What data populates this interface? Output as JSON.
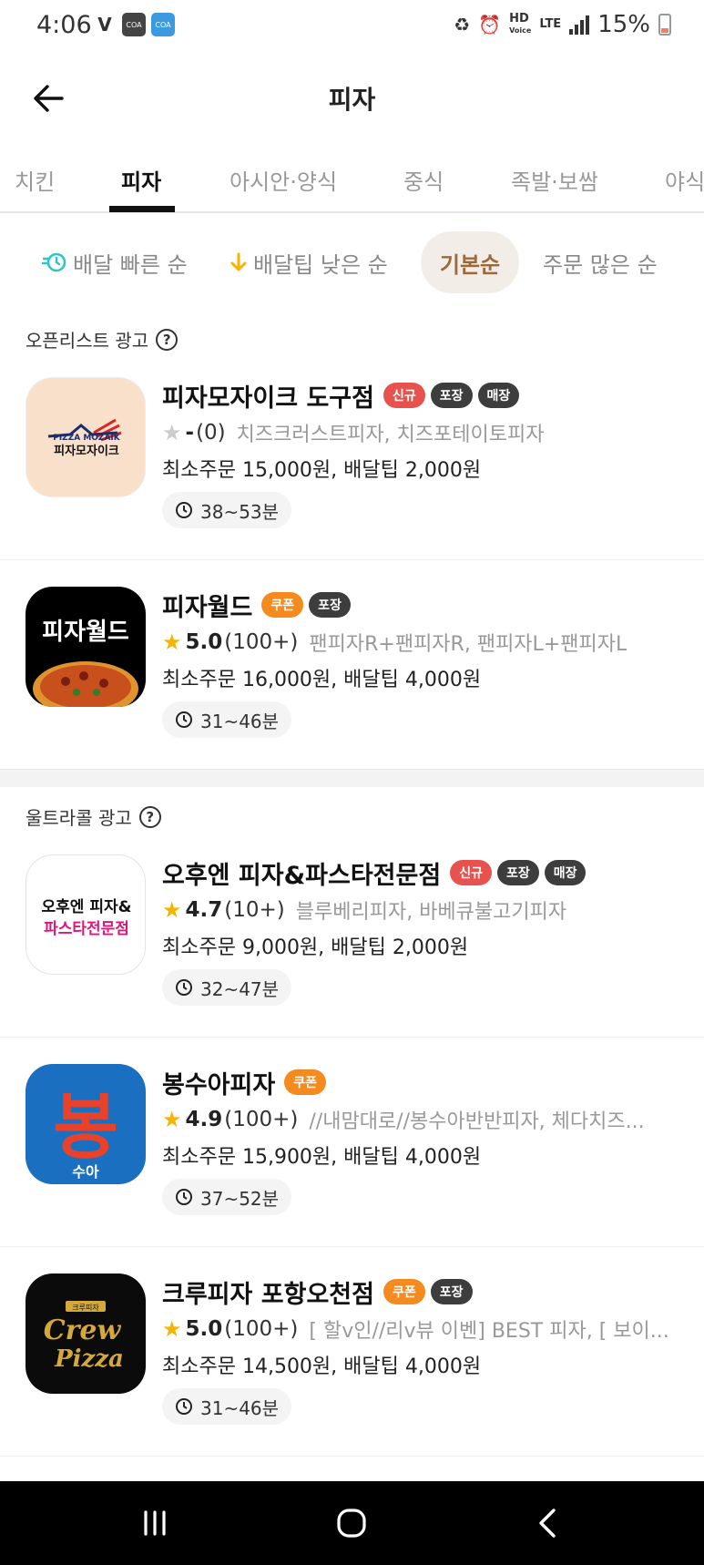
{
  "status_bar": {
    "time": "4:06",
    "hd_label": "HD",
    "voice_label": "Voice",
    "lte_label": "LTE",
    "battery": "15%",
    "coa_label": "COA"
  },
  "header": {
    "title": "피자"
  },
  "tabs": [
    "치킨",
    "피자",
    "아시안·양식",
    "중식",
    "족발·보쌈",
    "야식"
  ],
  "sort": {
    "fast": "배달 빠른 순",
    "low_tip": "배달팁 낮은 순",
    "default": "기본순",
    "most_orders": "주문 많은 순"
  },
  "sections": {
    "open_list": "오픈리스트 광고",
    "ultra_call": "울트라콜 광고"
  },
  "stores": [
    {
      "name": "피자모자이크 도구점",
      "badges": [
        "신규",
        "포장",
        "매장"
      ],
      "rating": "-",
      "count": "(0)",
      "menu": "치즈크러스트피자, 치즈포테이토피자",
      "minimum": "최소주문 15,000원, 배달팁 2,000원",
      "time": "38~53분",
      "logo_text": "피자모자이크",
      "logo_sub": "PIZZA MOZAIK"
    },
    {
      "name": "피자월드",
      "badges": [
        "쿠폰",
        "포장"
      ],
      "rating": "5.0",
      "count": "(100+)",
      "menu": "팬피자R+팬피자R, 팬피자L+팬피자L",
      "minimum": "최소주문 16,000원, 배달팁 4,000원",
      "time": "31~46분",
      "logo_text": "피자월드"
    },
    {
      "name": "오후엔 피자&파스타전문점",
      "badges": [
        "신규",
        "포장",
        "매장"
      ],
      "rating": "4.7",
      "count": "(10+)",
      "menu": "블루베리피자, 바베큐불고기피자",
      "minimum": "최소주문 9,000원, 배달팁 2,000원",
      "time": "32~47분",
      "logo_line1": "오후엔 피자&",
      "logo_line2": "파스타전문점"
    },
    {
      "name": "봉수아피자",
      "badges": [
        "쿠폰"
      ],
      "rating": "4.9",
      "count": "(100+)",
      "menu": "//내맘대로//봉수아반반피자, 체다치즈...",
      "minimum": "최소주문 15,900원, 배달팁 4,000원",
      "time": "37~52분",
      "logo_text": "봉",
      "logo_sub": "수아"
    },
    {
      "name": "크루피자 포항오천점",
      "badges": [
        "쿠폰",
        "포장"
      ],
      "rating": "5.0",
      "count": "(100+)",
      "menu": "[ 할v인//리v뷰 이벤] BEST 피자, [ 보이...",
      "minimum": "최소주문 14,500원, 배달팁 4,000원",
      "time": "31~46분",
      "logo_top": "크루피자",
      "logo_line1": "Crew",
      "logo_line2": "Pizza"
    }
  ],
  "colors": {
    "coupon": "#f58a1f",
    "new": "#e8524e",
    "dark_badge": "#3d3d3d",
    "star": "#f5b400",
    "sort_active": "#9b6a3c"
  }
}
